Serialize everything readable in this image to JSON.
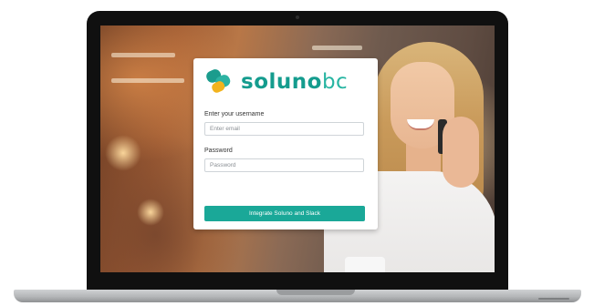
{
  "brand": {
    "name_main": "soluno",
    "name_accent": "bc",
    "colors": {
      "primary": "#149c8e",
      "accent": "#27b5a2",
      "button": "#1aa898"
    },
    "logo_icon": "soluno-logo-icon"
  },
  "login": {
    "username_label": "Enter your username",
    "username_placeholder": "Enter email",
    "username_value": "",
    "password_label": "Password",
    "password_placeholder": "Password",
    "password_value": "",
    "submit_label": "Integrate Soluno and Slack"
  }
}
